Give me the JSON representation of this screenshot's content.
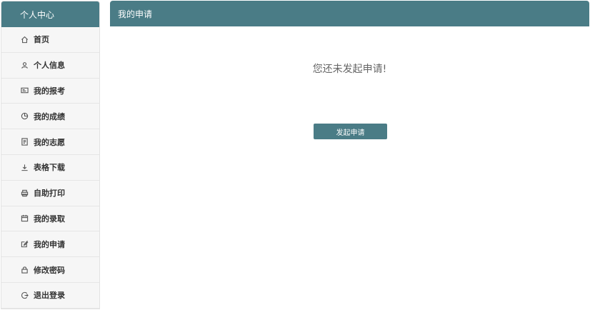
{
  "sidebar": {
    "title": "个人中心",
    "items": [
      {
        "label": "首页",
        "icon": "home-icon"
      },
      {
        "label": "个人信息",
        "icon": "user-icon"
      },
      {
        "label": "我的报考",
        "icon": "id-card-icon"
      },
      {
        "label": "我的成绩",
        "icon": "pie-chart-icon"
      },
      {
        "label": "我的志愿",
        "icon": "document-icon"
      },
      {
        "label": "表格下载",
        "icon": "download-icon"
      },
      {
        "label": "自助打印",
        "icon": "printer-icon"
      },
      {
        "label": "我的录取",
        "icon": "calendar-icon"
      },
      {
        "label": "我的申请",
        "icon": "edit-icon"
      },
      {
        "label": "修改密码",
        "icon": "lock-icon"
      },
      {
        "label": "退出登录",
        "icon": "logout-icon"
      }
    ]
  },
  "main": {
    "title": "我的申请",
    "empty_message": "您还未发起申请!",
    "apply_button": "发起申请"
  },
  "colors": {
    "accent": "#4a7c86"
  }
}
